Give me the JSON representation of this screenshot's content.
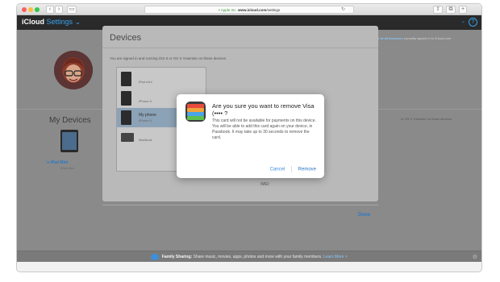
{
  "browser": {
    "url_prefix": "Apple Inc.",
    "url_domain": "www.icloud.com",
    "url_path": "/settings"
  },
  "app": {
    "title": "iCloud",
    "subtitle": "Settings"
  },
  "page": {
    "signout_link": "Sign out of all browsers",
    "signout_desc": "currently signed in to iCloud.com",
    "my_devices_label": "My Devices",
    "mini_device_name": "'s iPad Mini",
    "mini_device_sub": "iPad mini",
    "bg_right_text": "or OS X Yosemite on these devices."
  },
  "devices_panel": {
    "title": "Devices",
    "subtitle": "You are signed in and running iOS 8 or OS X Yosemite on these devices.",
    "devices": [
      {
        "name": "",
        "sub": "iPad mini",
        "selected": false
      },
      {
        "name": "",
        "sub": "iPhone 6",
        "selected": false
      },
      {
        "name": "My phone",
        "sub": "iPhone 6",
        "selected": true
      },
      {
        "name": "",
        "sub": "MacBook",
        "selected": false
      }
    ],
    "imei_label": "IMEI:",
    "done_label": "Done"
  },
  "alert": {
    "title": "Are you sure you want to remove Visa (•••• ?",
    "body": "This card will not be available for payments on this device. You will be able to add this card again on your device, in Passbook. It may take up to 30 seconds to remove the card.",
    "cancel_label": "Cancel",
    "remove_label": "Remove"
  },
  "footer": {
    "title": "Family Sharing:",
    "text": "Share music, movies, apps, photos and more with your family members.",
    "link": "Learn More >"
  },
  "colors": {
    "accent": "#2a79c4",
    "wallet_cards": [
      "#e84b3c",
      "#f2a23a",
      "#4aa4e8",
      "#5cbf4f"
    ]
  }
}
